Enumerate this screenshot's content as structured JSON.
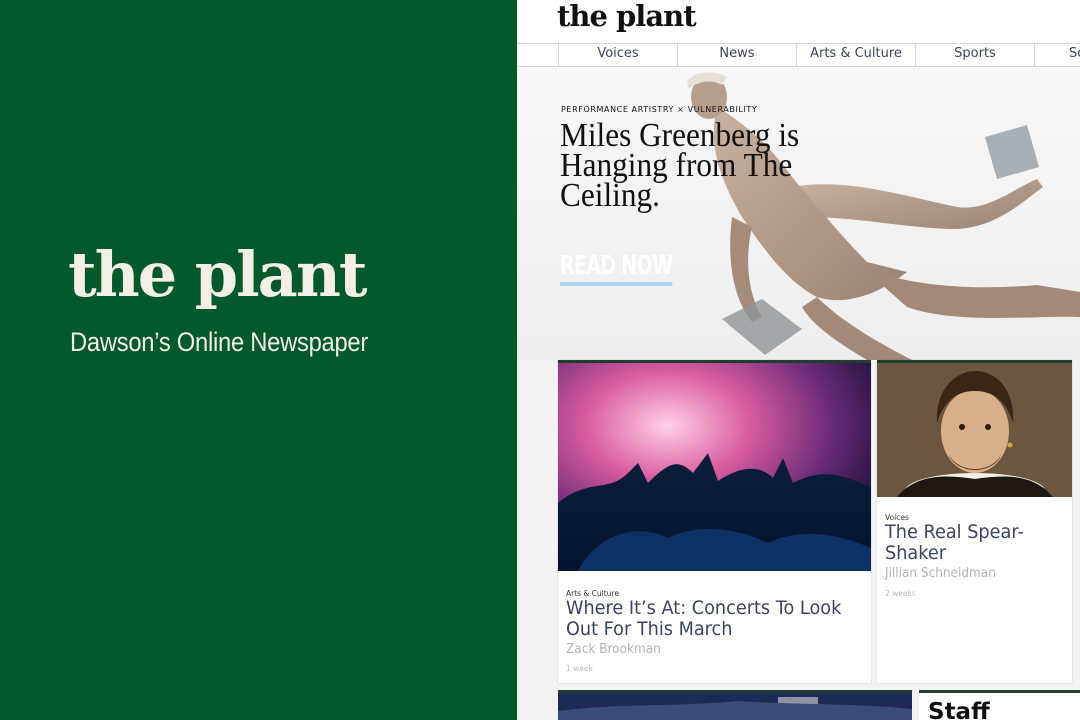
{
  "promo": {
    "logo": "the plant",
    "tagline": "Dawson’s Online Newspaper"
  },
  "site": {
    "logo": "the plant",
    "nav": [
      "Voices",
      "News",
      "Arts & Culture",
      "Sports",
      "Sc"
    ]
  },
  "hero": {
    "kicker": "PERFORMANCE ARTISTRY × VULNERABILITY",
    "title": "Miles Greenberg is Hanging from The Ceiling.",
    "cta": "READ NOW"
  },
  "cards": [
    {
      "category": "Arts & Culture",
      "title": "Where It’s At: Concerts To Look Out For This March",
      "author": "Zack Brookman",
      "time": "1 week"
    },
    {
      "category": "Voices",
      "title": "The Real Spear-Shaker",
      "author": "Jillian Schneidman",
      "time": "2 weeks"
    }
  ],
  "sidebar": {
    "staff_label": "Staff"
  },
  "colors": {
    "brand_green": "#02592a",
    "headline_navy": "#3b4561",
    "cta_underline": "#a9d8ea"
  }
}
